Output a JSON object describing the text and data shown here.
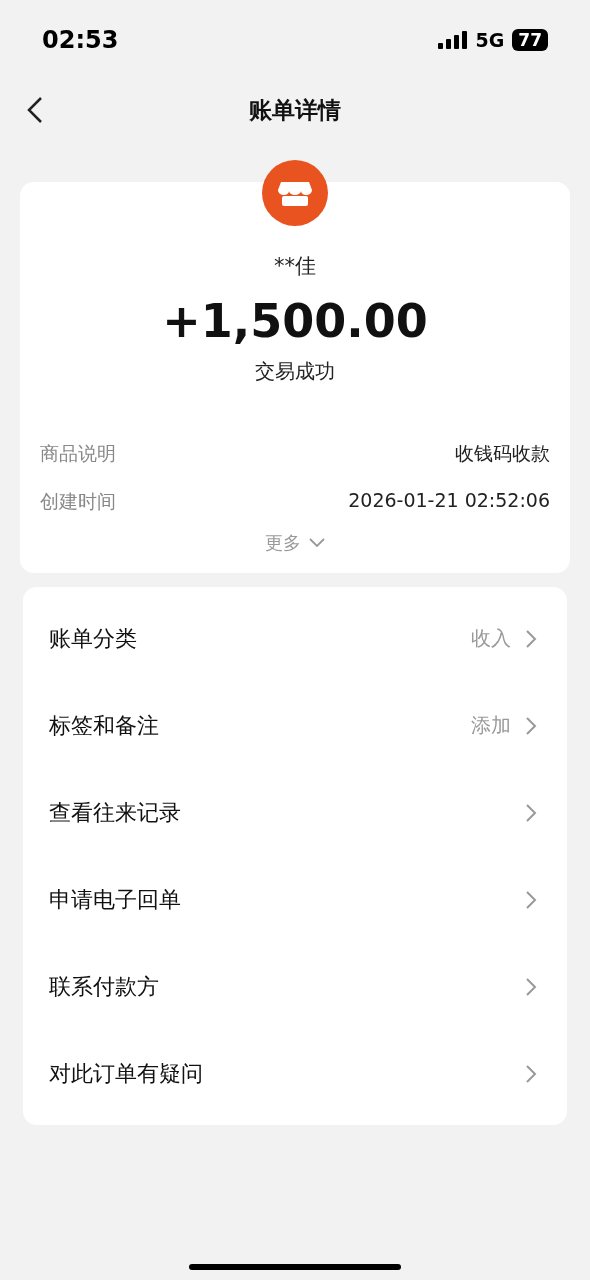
{
  "status_bar": {
    "time": "02:53",
    "network": "5G",
    "battery": "77"
  },
  "nav": {
    "title": "账单详情"
  },
  "summary": {
    "payer": "**佳",
    "amount": "+1,500.00",
    "status": "交易成功",
    "details": [
      {
        "label": "商品说明",
        "value": "收钱码收款"
      },
      {
        "label": "创建时间",
        "value": "2026-01-21 02:52:06"
      }
    ],
    "more": "更多"
  },
  "menu": [
    {
      "label": "账单分类",
      "value": "收入"
    },
    {
      "label": "标签和备注",
      "value": "添加"
    },
    {
      "label": "查看往来记录"
    },
    {
      "label": "申请电子回单"
    },
    {
      "label": "联系付款方"
    },
    {
      "label": "对此订单有疑问"
    }
  ]
}
